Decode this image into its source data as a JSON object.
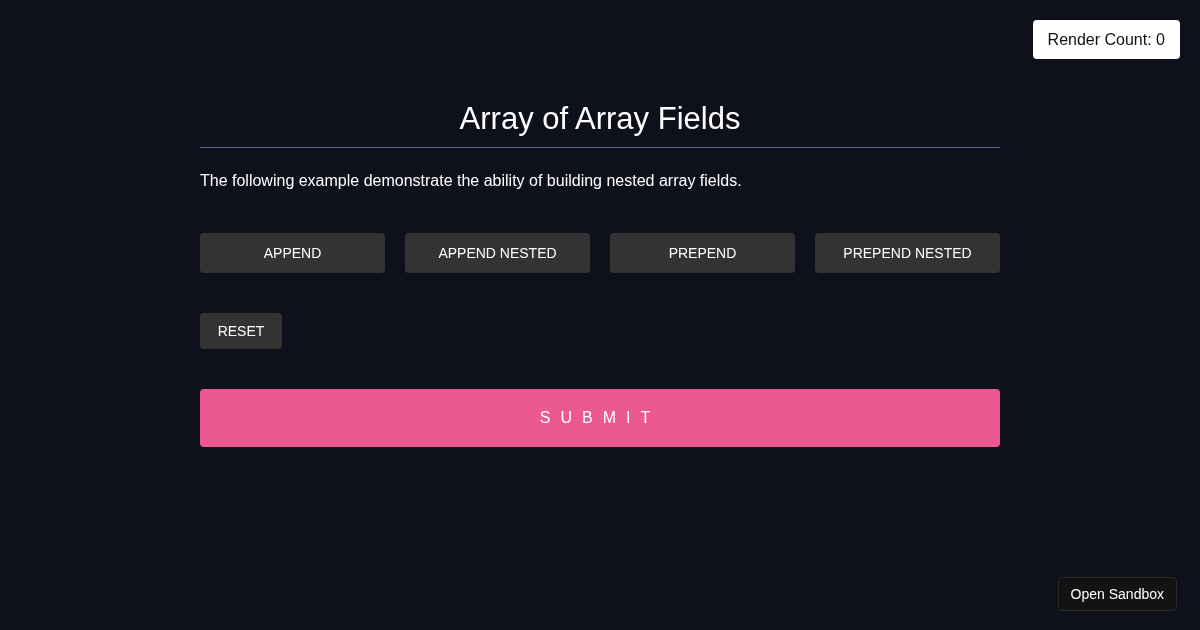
{
  "render_count": "Render Count: 0",
  "title": "Array of Array Fields",
  "description": "The following example demonstrate the ability of building nested array fields.",
  "action_buttons": [
    "APPEND",
    "APPEND NESTED",
    "PREPEND",
    "PREPEND NESTED"
  ],
  "reset_button": "RESET",
  "submit_button": "SUBMIT",
  "sandbox_button": "Open Sandbox"
}
